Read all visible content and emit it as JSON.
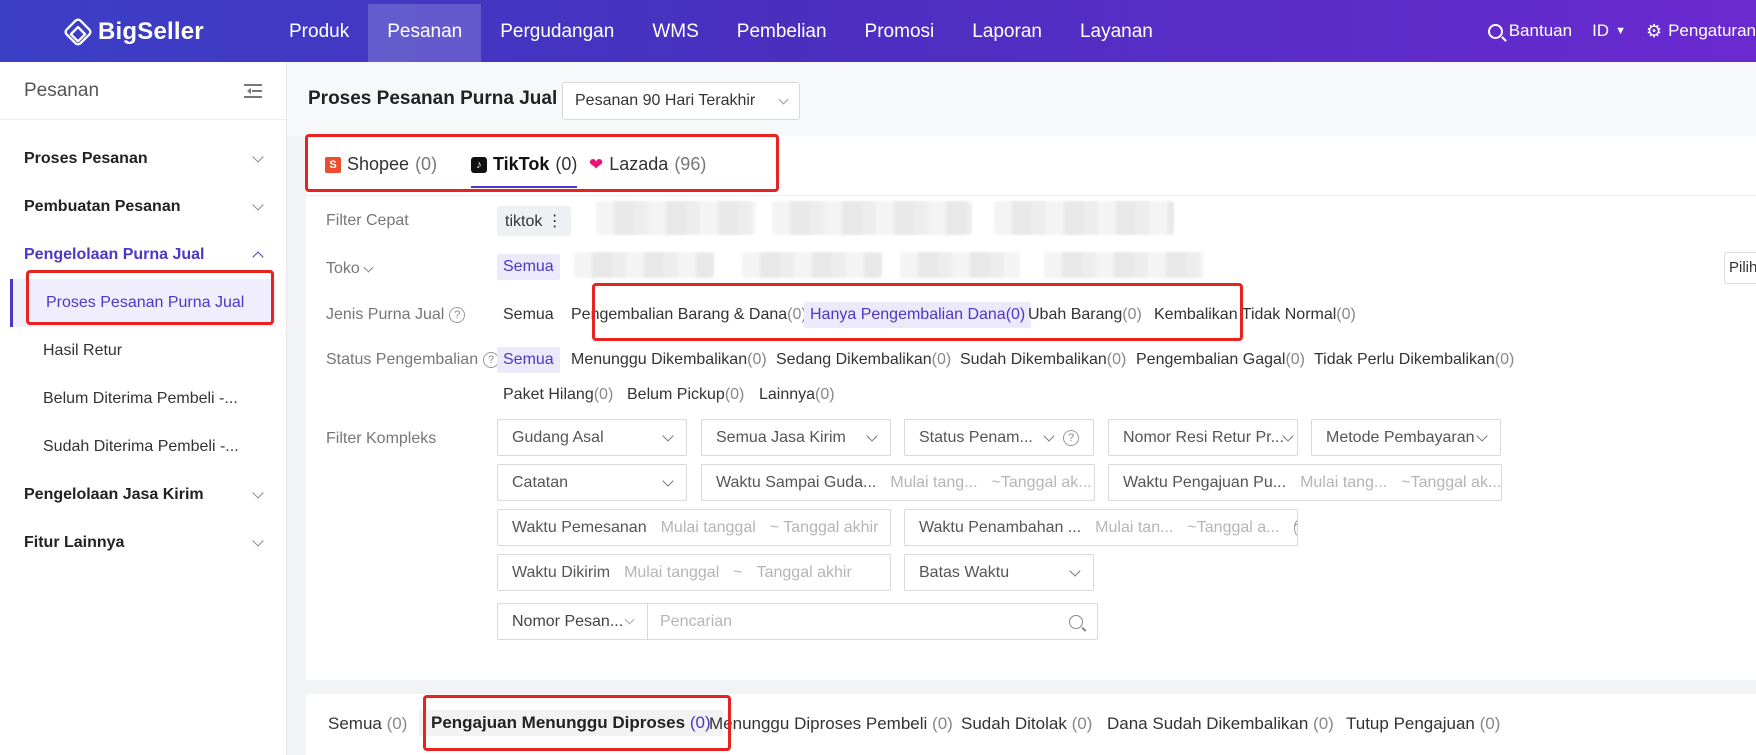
{
  "app": {
    "logo_text": "BigSeller"
  },
  "topnav": {
    "items": [
      "Produk",
      "Pesanan",
      "Pergudangan",
      "WMS",
      "Pembelian",
      "Promosi",
      "Laporan",
      "Layanan"
    ],
    "active_index": 1,
    "help": "Bantuan",
    "language": "ID",
    "settings": "Pengaturan"
  },
  "sidebar": {
    "title": "Pesanan",
    "groups": [
      "Proses Pesanan",
      "Pembuatan Pesanan",
      "Pengelolaan Purna Jual",
      "Pengelolaan Jasa Kirim",
      "Fitur Lainnya"
    ],
    "sub_items": [
      "Proses Pesanan Purna Jual",
      "Hasil Retur",
      "Belum Diterima Pembeli -...",
      "Sudah Diterima Pembeli -..."
    ]
  },
  "header": {
    "title": "Proses Pesanan Purna Jual",
    "range": "Pesanan 90 Hari Terakhir"
  },
  "platform_tabs": [
    {
      "label": "Shopee",
      "count": "(0)"
    },
    {
      "label": "TikTok",
      "count": "(0)"
    },
    {
      "label": "Lazada",
      "count": "(96)"
    }
  ],
  "filters": {
    "quick_label": "Filter Cepat",
    "quick_tag": "tiktok ⋮",
    "store_label": "Toko",
    "store_all": "Semua",
    "store_edge": "Pilih",
    "type_label": "Jenis Purna Jual",
    "type_options": [
      {
        "label": "Semua",
        "count": ""
      },
      {
        "label": "Pengembalian Barang & Dana",
        "count": "(0)"
      },
      {
        "label": "Hanya Pengembalian Dana",
        "count": "(0)"
      },
      {
        "label": "Ubah Barang",
        "count": "(0)"
      },
      {
        "label": "Kembalikan Tidak Normal",
        "count": "(0)"
      }
    ],
    "return_status_label": "Status Pengembalian",
    "return_status_options": [
      {
        "label": "Semua",
        "count": ""
      },
      {
        "label": "Menunggu Dikembalikan",
        "count": "(0)"
      },
      {
        "label": "Sedang Dikembalikan",
        "count": "(0)"
      },
      {
        "label": "Sudah Dikembalikan",
        "count": "(0)"
      },
      {
        "label": "Pengembalian Gagal",
        "count": "(0)"
      },
      {
        "label": "Tidak Perlu Dikembalikan",
        "count": "(0)"
      },
      {
        "label": "Paket Hilang",
        "count": "(0)"
      },
      {
        "label": "Belum Pickup",
        "count": "(0)"
      },
      {
        "label": "Lainnya",
        "count": "(0)"
      }
    ],
    "complex_label": "Filter Kompleks",
    "selects": {
      "warehouse": "Gudang Asal",
      "courier": "Semua Jasa Kirim",
      "receipt_status": "Status Penam...",
      "return_awb": "Nomor Resi Retur Pr...",
      "payment": "Metode Pembayaran",
      "notes": "Catatan",
      "deadline": "Batas Waktu"
    },
    "dates": {
      "arrive_label": "Waktu Sampai Guda...",
      "arrive_start": "Mulai tang...",
      "arrive_end": "~Tanggal ak...",
      "submit_label": "Waktu Pengajuan Pu...",
      "submit_start": "Mulai tang...",
      "submit_end": "~Tanggal ak...",
      "order_label": "Waktu Pemesanan",
      "order_start": "Mulai tanggal",
      "order_end": "~ Tanggal akhir",
      "added_label": "Waktu Penambahan ...",
      "added_start": "Mulai tan...",
      "added_end": "~Tanggal a...",
      "sent_label": "Waktu Dikirim",
      "sent_start": "Mulai tanggal",
      "sent_sep": "~",
      "sent_end": "Tanggal akhir"
    },
    "search_type": "Nomor Pesan...",
    "search_placeholder": "Pencarian"
  },
  "status_tabs": [
    {
      "label": "Semua",
      "count": "(0)"
    },
    {
      "label": "Pengajuan Menunggu Diproses",
      "count": "(0)"
    },
    {
      "label": "Menunggu Diproses Pembeli",
      "count": "(0)"
    },
    {
      "label": "Sudah Ditolak",
      "count": "(0)"
    },
    {
      "label": "Dana Sudah Dikembalikan",
      "count": "(0)"
    },
    {
      "label": "Tutup Pengajuan",
      "count": "(0)"
    }
  ],
  "colors": {
    "brand": "#4b38c6",
    "highlight": "#e6231f"
  }
}
